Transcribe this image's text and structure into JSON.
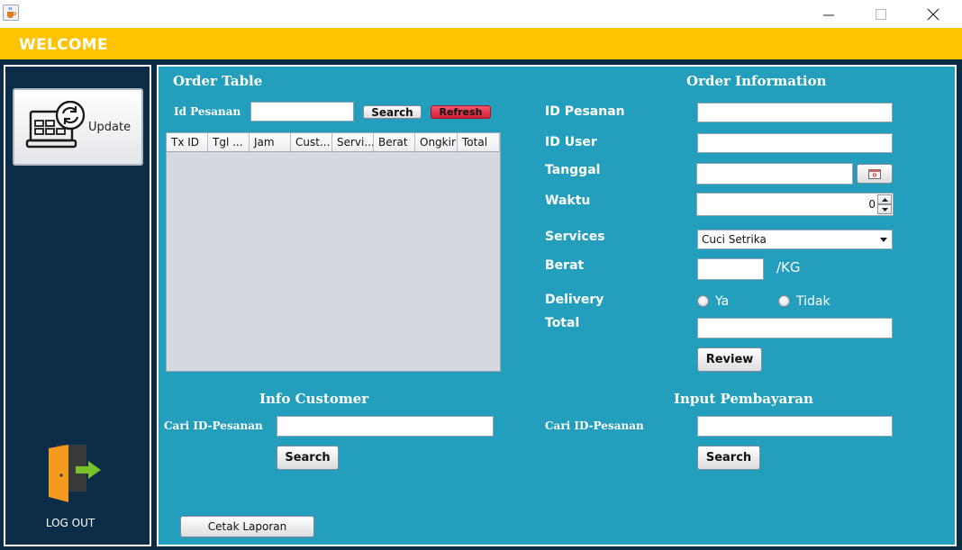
{
  "window": {
    "app_icon": "java-cup-icon",
    "controls": [
      "minimize-icon",
      "maximize-icon",
      "close-icon"
    ]
  },
  "header": {
    "title": "WELCOME"
  },
  "sidebar": {
    "update_label": "Update",
    "update_icon": "laptop-refresh-icon",
    "logout_label": "LOG OUT",
    "logout_icon": "door-exit-icon"
  },
  "order_table": {
    "title": "Order Table",
    "id_label": "Id Pesanan",
    "id_value": "",
    "search_label": "Search",
    "refresh_label": "Refresh",
    "columns": [
      "Tx ID",
      "Tgl ...",
      "Jam",
      "Cust...",
      "Servi...",
      "Berat",
      "Ongkir",
      "Total"
    ],
    "rows": []
  },
  "order_info": {
    "title": "Order Information",
    "id_pesanan_label": "ID Pesanan",
    "id_pesanan_value": "",
    "id_user_label": "ID User",
    "id_user_value": "",
    "tanggal_label": "Tanggal",
    "tanggal_value": "",
    "calendar_icon": "calendar-icon",
    "waktu_label": "Waktu",
    "waktu_value": "0",
    "services_label": "Services",
    "services_selected": "Cuci Setrika",
    "berat_label": "Berat",
    "berat_value": "",
    "berat_unit": "/KG",
    "delivery_label": "Delivery",
    "delivery_options": [
      "Ya",
      "Tidak"
    ],
    "total_label": "Total",
    "total_value": "",
    "review_label": "Review"
  },
  "info_customer": {
    "title": "Info Customer",
    "search_label_text": "Cari ID-Pesanan",
    "search_value": "",
    "search_button": "Search"
  },
  "input_pembayaran": {
    "title": "Input Pembayaran",
    "search_label_text": "Cari ID-Pesanan",
    "search_value": "",
    "search_button": "Search"
  },
  "report": {
    "print_label": "Cetak Laporan"
  },
  "colors": {
    "header": "#ffc300",
    "sidebar": "#0b2d47",
    "content": "#239fbd",
    "refresh": "#e0243a"
  }
}
